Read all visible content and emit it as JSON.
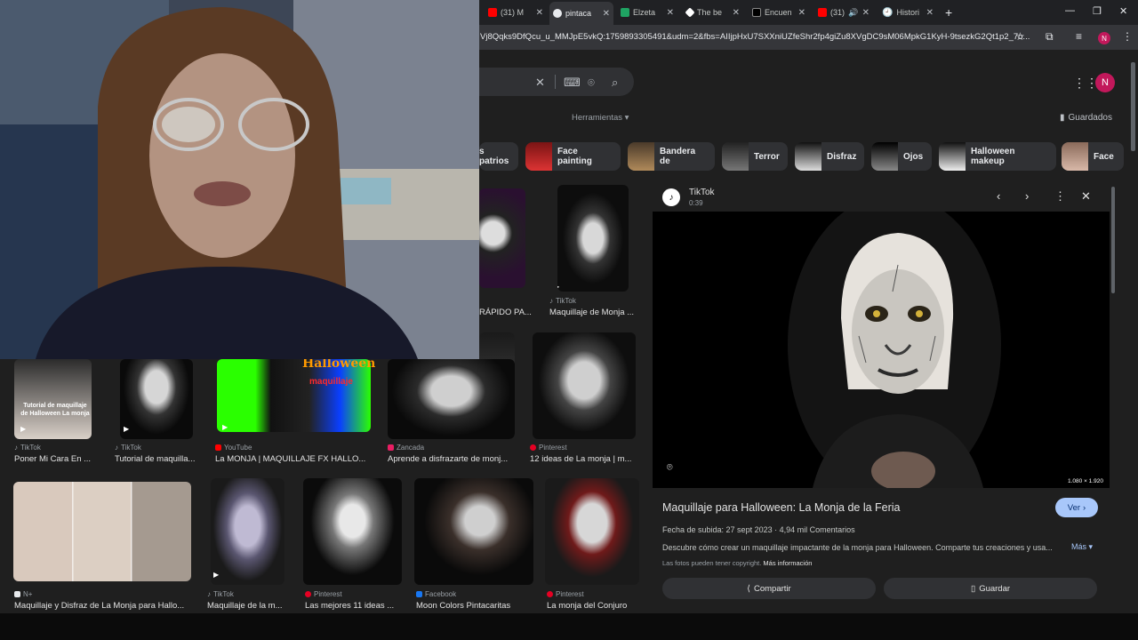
{
  "tabs": [
    {
      "label": "(31) M",
      "color": "#ff0000"
    },
    {
      "label": "pintaca",
      "color": "#e8eaed"
    },
    {
      "label": "Elzeta",
      "color": "#1fa463"
    },
    {
      "label": "The be",
      "color": "#ffffff"
    },
    {
      "label": "Encuen",
      "color": "#000000"
    },
    {
      "label": "(31)",
      "color": "#ff0000"
    },
    {
      "label": "Histori",
      "color": "#9aa0a6"
    }
  ],
  "address": {
    "url": "Vj8Qqks9DfQcu_u_MMJpE5vkQ:1759893305491&udm=2&fbs=AIIjpHxU7SXXniUZfeShr2fp4giZu8XVgDC9sM06MpkG1KyH-9tsezkG2Qt1p2_7o...",
    "avatar": "N"
  },
  "google": {
    "tools_label": "Herramientas",
    "saved_label": "Guardados",
    "avatar": "N"
  },
  "chips": [
    {
      "label": "s patrios"
    },
    {
      "label": "Face painting"
    },
    {
      "label": "Bandera de"
    },
    {
      "label": "Terror"
    },
    {
      "label": "Disfraz"
    },
    {
      "label": "Ojos"
    },
    {
      "label": "Halloween makeup"
    },
    {
      "label": "Face"
    }
  ],
  "results": [
    {
      "source": "",
      "title": "RÁPIDO PA..."
    },
    {
      "source": "TikTok",
      "title": "Maquillaje de Monja ..."
    },
    {
      "source": "TikTok",
      "title": "Poner Mi Cara En ..."
    },
    {
      "source": "TikTok",
      "title": "Tutorial de maquilla..."
    },
    {
      "source": "YouTube",
      "title": "La MONJA | MAQUILLAJE FX HALLO..."
    },
    {
      "source": "Zancada",
      "title": "Aprende a disfrazarte de monj..."
    },
    {
      "source": "Pinterest",
      "title": "12 ideas de La monja | m..."
    },
    {
      "source": "N+",
      "title": "Maquillaje y Disfraz de La Monja para Hallo..."
    },
    {
      "source": "TikTok",
      "title": "Maquillaje de la m..."
    },
    {
      "source": "Pinterest",
      "title": "Las mejores 11 ideas ..."
    },
    {
      "source": "Facebook",
      "title": "Moon Colors Pintacaritas"
    },
    {
      "source": "Pinterest",
      "title": "La monja del Conjuro"
    }
  ],
  "thumb_text": {
    "tutorial": "Tutorial de maquillaje de Halloween La monja",
    "halloween": "Halloween",
    "maquillaje": "maquillaje"
  },
  "preview": {
    "source": "TikTok",
    "duration": "0:39",
    "dimensions": "1.080 × 1.920",
    "title": "Maquillaje para Halloween: La Monja de la Feria",
    "view_label": "Ver",
    "meta": "Fecha de subida: 27 sept 2023 · 4,94 mil Comentarios",
    "description": "Descubre cómo crear un maquillaje impactante de la monja para Halloween. Comparte tus creaciones y usa...",
    "more_label": "Más",
    "copyright": "Las fotos pueden tener copyright.",
    "more_info": "Más información",
    "share_label": "Compartir",
    "save_label": "Guardar"
  }
}
